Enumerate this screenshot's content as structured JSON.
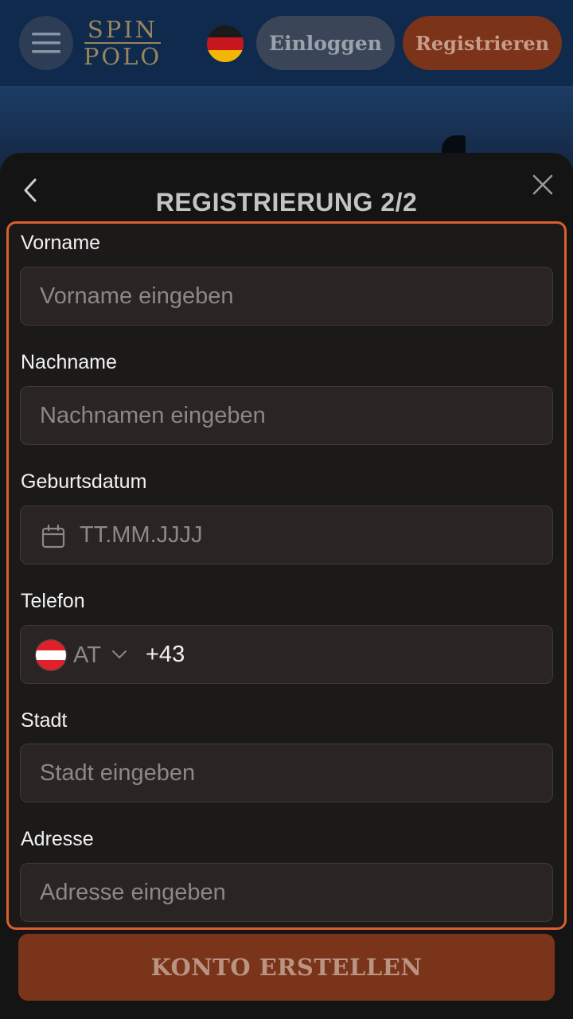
{
  "header": {
    "logo_line1": "SPIN",
    "logo_line2": "POLO",
    "language_flag": "de-flag-icon",
    "login_label": "Einloggen",
    "register_label": "Registrieren"
  },
  "modal": {
    "title": "REGISTRIERUNG 2/2",
    "fields": {
      "firstname": {
        "label": "Vorname",
        "placeholder": "Vorname eingeben",
        "value": ""
      },
      "lastname": {
        "label": "Nachname",
        "placeholder": "Nachnamen eingeben",
        "value": ""
      },
      "birthdate": {
        "label": "Geburtsdatum",
        "placeholder": "TT.MM.JJJJ",
        "value": ""
      },
      "phone": {
        "label": "Telefon",
        "country_code": "AT",
        "prefix": "+43",
        "value": ""
      },
      "city": {
        "label": "Stadt",
        "placeholder": "Stadt eingeben",
        "value": ""
      },
      "address": {
        "label": "Adresse",
        "placeholder": "Adresse eingeben",
        "value": ""
      }
    },
    "submit_label": "KONTO ERSTELLEN"
  },
  "colors": {
    "accent": "#d9602c",
    "button_primary": "#7a3419",
    "header_bg": "#0f2a4c",
    "modal_bg": "#141414"
  },
  "icons": {
    "menu": "hamburger-menu-icon",
    "back": "chevron-left-icon",
    "close": "close-icon",
    "calendar": "calendar-icon",
    "phone_flag": "at-flag-icon",
    "dropdown": "chevron-down-icon"
  }
}
